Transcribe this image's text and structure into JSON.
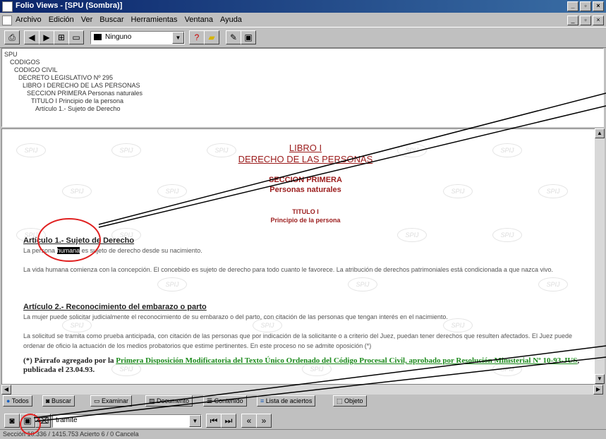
{
  "window": {
    "title": "Folio Views - [SPU (Sombra)]"
  },
  "menu": [
    "Archivo",
    "Edición",
    "Ver",
    "Buscar",
    "Herramientas",
    "Ventana",
    "Ayuda"
  ],
  "toolbar": {
    "view_combo_value": "Ninguno"
  },
  "tree": [
    "SPU",
    "CODIGOS",
    "CODIGO CIVIL",
    "DECRETO LEGISLATIVO Nº 295",
    "LIBRO I DERECHO DE LAS PERSONAS",
    "SECCION PRIMERA Personas naturales",
    "TITULO I Principio de la persona",
    "Artículo 1.- Sujeto de Derecho"
  ],
  "document": {
    "book_title": "LIBRO I",
    "book_subtitle": "DERECHO DE LAS PERSONAS",
    "section_title": "SECCION PRIMERA",
    "section_subtitle": "Personas naturales",
    "titulo": "TITULO I",
    "titulo_subtitle": "Principio de la persona",
    "watermark": "SPIJ",
    "art1": {
      "heading": "Artículo 1.- Sujeto de Derecho",
      "p1_before": "La persona",
      "p1_highlight": "humana",
      "p1_after": "es sujeto de derecho desde su nacimiento.",
      "p2": "La vida humana comienza con la concepción. El concebido es sujeto de derecho para todo cuanto le favorece. La atribución de derechos patrimoniales está condicionada a que nazca vivo."
    },
    "art2": {
      "heading": "Artículo 2.- Reconocimiento del embarazo o parto",
      "p1": "La mujer puede solicitar judicialmente el reconocimiento de su embarazo o del parto, con citación de las personas que tengan interés en el nacimiento.",
      "p2": "La solicitud se tramita como prueba anticipada, con citación de las personas que por indicación de la solicitante o a criterio del Juez, puedan tener derechos que resulten afectados. El Juez puede ordenar de oficio la actuación de los medios probatorios que estime pertinentes. En este proceso no se admite oposición (*)",
      "note_prefix": "(*) Párrafo agregado por la",
      "note_link": "Primera Disposición Modificatoria del Texto Único Ordenado del Código Procesal Civil, aprobado por Resolución Ministerial Nº 10-93-JUS",
      "note_suffix": ", publicada el 23.04.93."
    }
  },
  "tabs": [
    "Todos",
    "Buscar",
    "Examinar",
    "Documento",
    "Contenido",
    "Lista de aciertos",
    "Objeto"
  ],
  "search": {
    "query": "tramite"
  },
  "status": "Sección 10.336 / 1415.753  Acierto 6 / 0  Cancela"
}
